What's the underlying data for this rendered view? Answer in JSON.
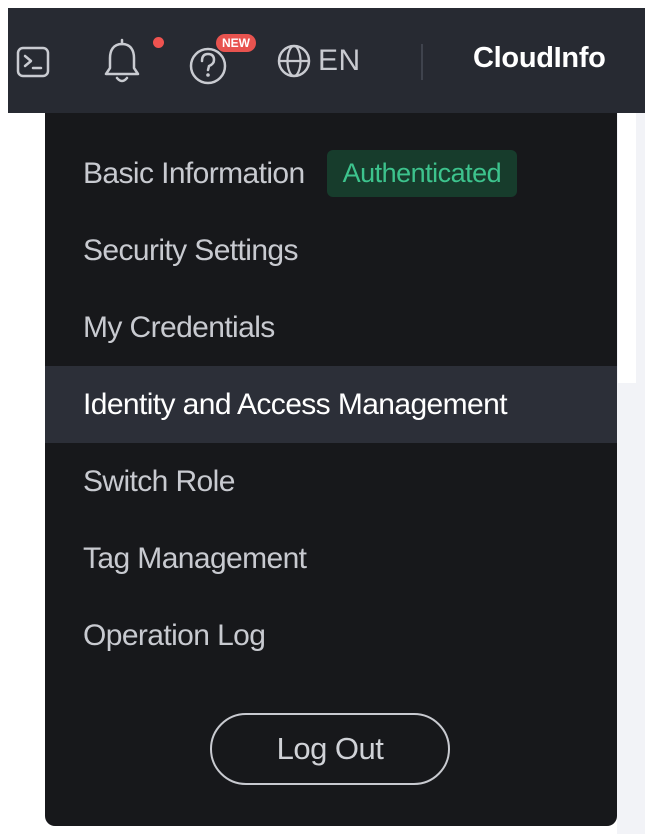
{
  "topbar": {
    "icons": {
      "terminal": "terminal-icon",
      "notifications": "bell-icon",
      "help": "help-icon",
      "language": "globe-icon"
    },
    "help_badge": "NEW",
    "language": "EN",
    "account_name": "CloudInfo"
  },
  "menu": {
    "items": [
      {
        "label": "Basic Information",
        "badge": "Authenticated"
      },
      {
        "label": "Security Settings"
      },
      {
        "label": "My Credentials"
      },
      {
        "label": "Identity and Access Management"
      },
      {
        "label": "Switch Role"
      },
      {
        "label": "Tag Management"
      },
      {
        "label": "Operation Log"
      }
    ],
    "active_item": "Identity and Access Management",
    "logout_label": "Log Out"
  },
  "colors": {
    "topbar_bg": "#272a32",
    "menu_bg": "#17181b",
    "active_bg": "#2c2f38",
    "badge_green": "#3dc38d",
    "notify_red": "#ef5350"
  }
}
